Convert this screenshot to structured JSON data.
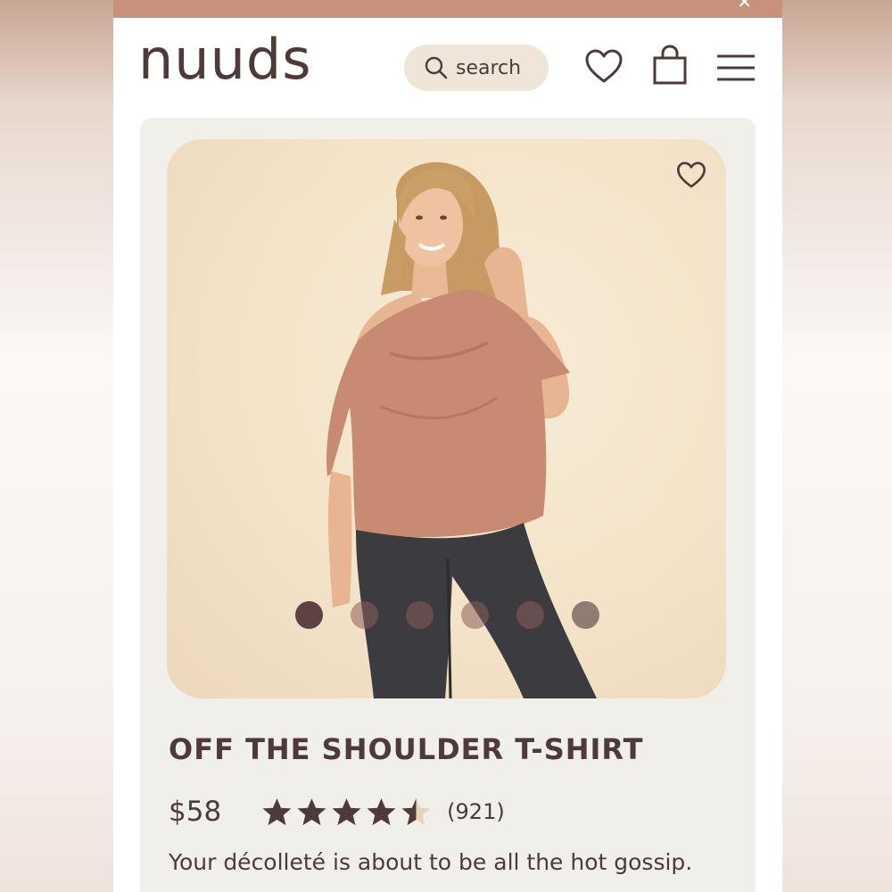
{
  "header": {
    "logo": "nuuds",
    "search_label": "search"
  },
  "product": {
    "title": "OFF THE SHOULDER T-SHIRT",
    "price": "$58",
    "rating_count": "(921)",
    "rating": 4.5,
    "rating_max": 5,
    "description": "Your décolleté is about to be all the hot gossip.",
    "image_slides": 6,
    "active_slide": 1
  },
  "colors": {
    "brand_text": "#4e3a38",
    "search_bg": "#efe6d9",
    "top_strip": "#c8917b",
    "shirt": "#c98a72",
    "jeans": "#3a3a3e"
  },
  "icons": [
    "close-icon",
    "search-icon",
    "heart-icon",
    "shopping-bag-icon",
    "menu-icon",
    "favorite-heart-icon",
    "star-icon"
  ]
}
